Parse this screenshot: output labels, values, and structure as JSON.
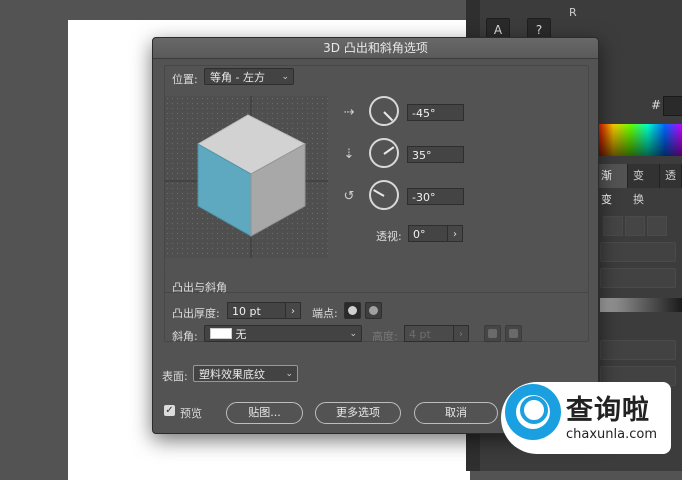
{
  "dialog": {
    "title": "3D 凸出和斜角选项",
    "position_label": "位置:",
    "position_value": "等角 - 左方",
    "rotation_x": "-45°",
    "rotation_y": "35°",
    "rotation_z": "-30°",
    "perspective_label": "透视:",
    "perspective_value": "0°",
    "bevel_section_title": "凸出与斜角",
    "extrude_depth_label": "凸出厚度:",
    "extrude_depth_value": "10 pt",
    "cap_label": "端点:",
    "bevel_label": "斜角:",
    "bevel_value": "无",
    "height_label": "高度:",
    "height_value": "4 pt",
    "surface_label": "表面:",
    "surface_value": "塑料效果底纹",
    "preview_label": "预览",
    "preview_checked": true,
    "map_button": "贴图...",
    "more_options_button": "更多选项",
    "cancel_button": "取消"
  },
  "background": {
    "tab_gradient": "渐变",
    "tab_transform": "变换",
    "tab_more": "透",
    "hash_label": "#",
    "top_letter": "R"
  },
  "cube_colors": {
    "top": "#d2d2d2",
    "left": "#5ea9bf",
    "right": "#a8a8a8"
  },
  "watermark": {
    "main": "查询啦",
    "sub": "chaxunla.com"
  }
}
